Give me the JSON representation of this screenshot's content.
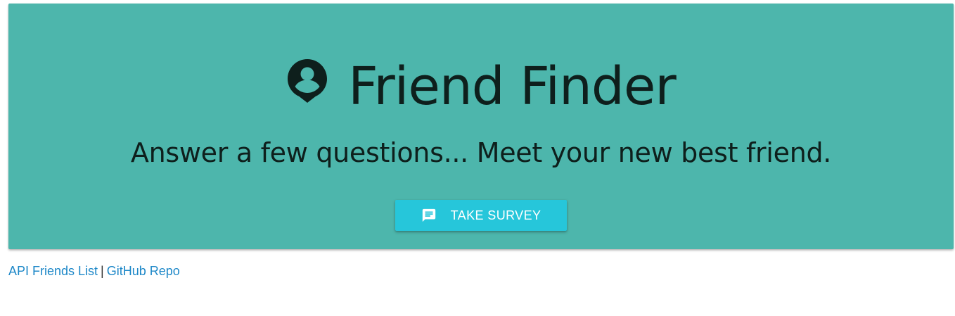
{
  "hero": {
    "icon": "person-pin-icon",
    "title": "Friend Finder",
    "subtitle": "Answer a few questions... Meet your new best friend.",
    "background_color": "#4db6ac"
  },
  "survey_button": {
    "icon": "chat-bubble-icon",
    "label": "TAKE SURVEY",
    "background_color": "#26c6da"
  },
  "footer": {
    "links": [
      {
        "label": "API Friends List"
      },
      {
        "label": "GitHub Repo"
      }
    ],
    "separator": "|",
    "link_color": "#1e88c8"
  }
}
